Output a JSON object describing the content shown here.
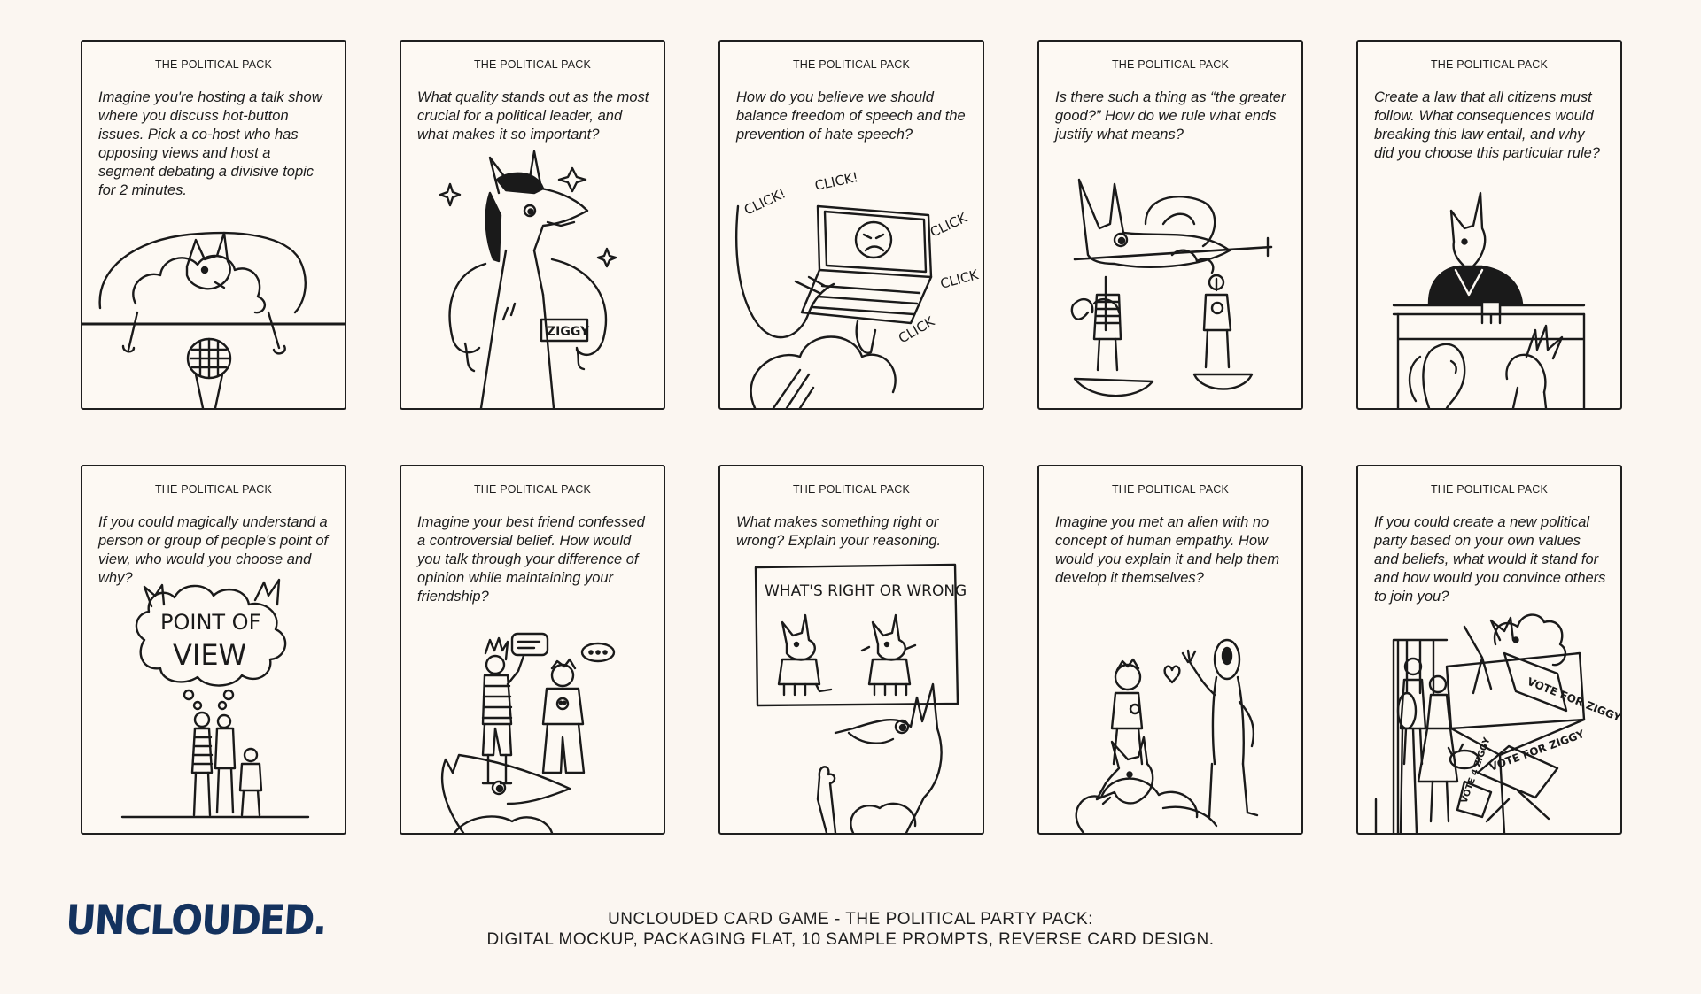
{
  "cards": [
    {
      "header": "THE POLITICAL PACK",
      "prompt": "Imagine you're hosting a talk show where you discuss hot-button issues. Pick a co-host who has opposing views and host a segment debating a divisive topic for 2 minutes.",
      "illustration": "fox-talk-show-host-microphone"
    },
    {
      "header": "THE POLITICAL PACK",
      "prompt": "What quality stands out as the most crucial for a political leader, and what makes it so important?",
      "illustration": "fox-politician-ziggy-badge",
      "art_text": "ZIGGY"
    },
    {
      "header": "THE POLITICAL PACK",
      "prompt": "How do you believe we should balance freedom of speech and the prevention of hate speech?",
      "illustration": "fox-typing-laptop",
      "art_text": [
        "CLICK!",
        "CLICK!",
        "CLICK",
        "CLICK",
        "CLICK"
      ]
    },
    {
      "header": "THE POLITICAL PACK",
      "prompt": "Is there such a thing as “the greater good?” How do we rule what ends justify what means?",
      "illustration": "fox-balance-scale"
    },
    {
      "header": "THE POLITICAL PACK",
      "prompt": "Create a law that all citizens must follow. What consequences would breaking this law entail, and why did you choose this particular rule?",
      "illustration": "fox-judge-courtroom"
    },
    {
      "header": "THE POLITICAL PACK",
      "prompt": "If you could magically understand a person or group of people's point of view, who would you choose and why?",
      "illustration": "point-of-view-cloud",
      "art_text": [
        "POINT OF",
        "VIEW"
      ]
    },
    {
      "header": "THE POLITICAL PACK",
      "prompt": "Imagine your best friend confessed a controversial belief. How would you talk through your difference of opinion while maintaining your friendship?",
      "illustration": "friends-talking-fox"
    },
    {
      "header": "THE POLITICAL PACK",
      "prompt": "What makes something right or wrong? Explain your reasoning.",
      "illustration": "fox-right-or-wrong-board",
      "art_text": "WHAT'S RIGHT OR WRONG"
    },
    {
      "header": "THE POLITICAL PACK",
      "prompt": "Imagine you met an alien with no concept of human empathy. How would you explain it and help them develop it themselves?",
      "illustration": "alien-meets-human"
    },
    {
      "header": "THE POLITICAL PACK",
      "prompt": "If you could create a new political party based on your own values and beliefs, what would it stand for and how would you convince others to join you?",
      "illustration": "vote-for-ziggy-rally",
      "art_text": [
        "VOTE FOR ZIGGY",
        "VOTE FOR ZIGGY",
        "VOTE 4 ZIGGY"
      ]
    }
  ],
  "footer": {
    "logo": "UNCLOUDED.",
    "caption_line1": "UNCLOUDED CARD GAME - THE POLITICAL PARTY PACK:",
    "caption_line2": "DIGITAL MOCKUP, PACKAGING FLAT, 10 SAMPLE PROMPTS, REVERSE CARD DESIGN."
  },
  "colors": {
    "background": "#fbf6f1",
    "card": "#fdf9f3",
    "ink": "#1a1a1a",
    "logo": "#14325e"
  }
}
